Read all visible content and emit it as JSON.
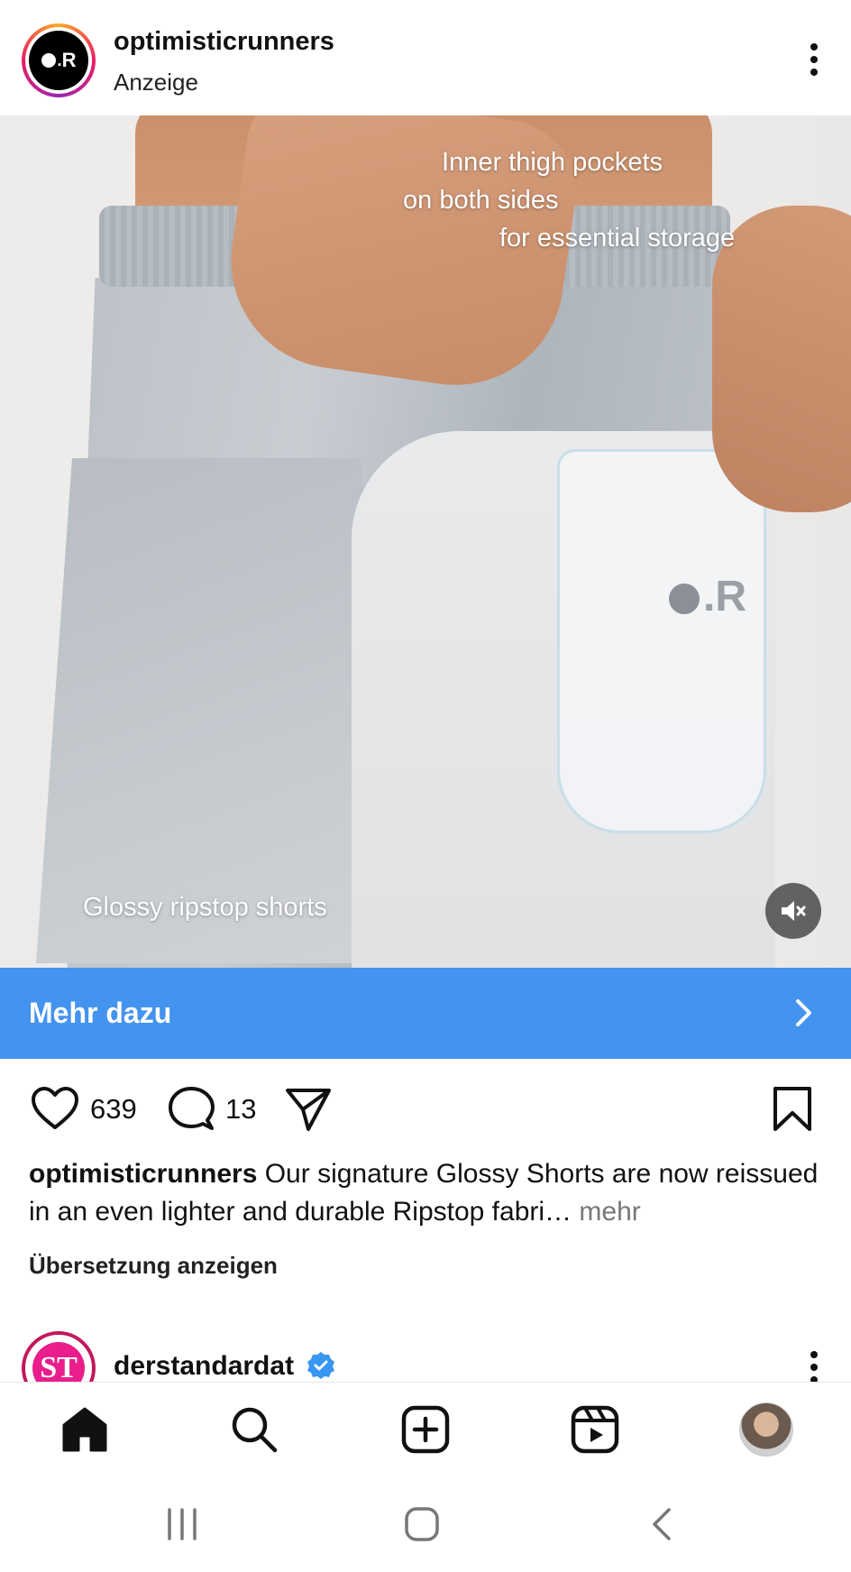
{
  "post": {
    "username": "optimisticrunners",
    "sponsored_label": "Anzeige",
    "avatar_text": "R",
    "media": {
      "overlay_line1": "Inner thigh pockets",
      "overlay_line2": "on both sides",
      "overlay_line3": "for essential storage",
      "overlay_bottom": "Glossy ripstop shorts",
      "pocket_logo": "R",
      "mute_icon": "volume-muted-icon"
    },
    "cta_label": "Mehr dazu",
    "likes": "639",
    "comments": "13",
    "caption_username": "optimisticrunners",
    "caption_text": "Our signature Glossy Shorts are now reissued in an even lighter and durable Ripstop fabri…",
    "caption_more": "mehr",
    "translate_label": "Übersetzung anzeigen"
  },
  "next_post": {
    "username": "derstandardat",
    "avatar_text": "ST",
    "verified": true
  },
  "colors": {
    "cta": "#4493ee",
    "verified": "#3897f0"
  },
  "nav": {
    "items": [
      "home-icon",
      "search-icon",
      "create-icon",
      "reels-icon",
      "profile-avatar"
    ]
  }
}
